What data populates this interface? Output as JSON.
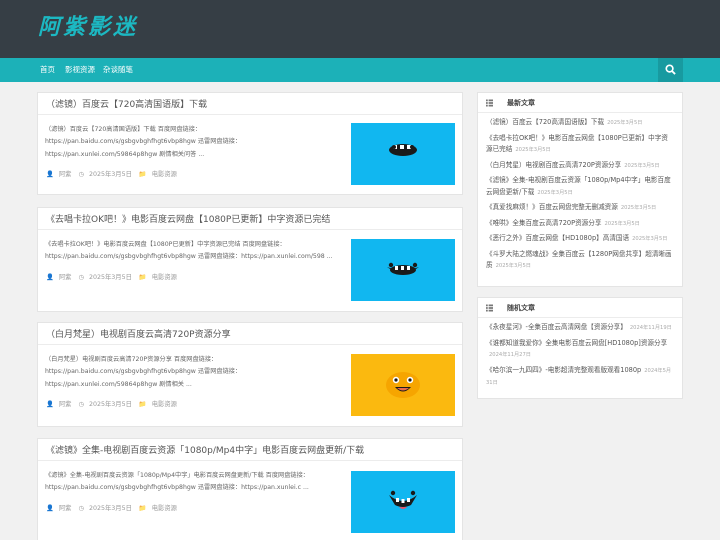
{
  "header": {
    "logo": "阿紫影迷"
  },
  "nav": {
    "items": [
      "首页",
      "影视资源",
      "杂谈随笔"
    ]
  },
  "posts": [
    {
      "title": "（滤镜）百度云【720高清国语版】下载",
      "excerpt": "（滤镜）百度云【720高清国语版】下载 百度网盘链接：https://pan.baidu.com/s/gsbgvbghfhgt6vbp8hgw 迅雷网盘链接：https://pan.xunlei.com/59864p8hgw 剧情相关问答 ...",
      "author": "阿紫",
      "date": "2025年3月5日",
      "category": "电影资源",
      "thumb": "teal"
    },
    {
      "title": "《去唱卡拉OK吧！》电影百度云网盘【1080P已更新】中字资源已完结",
      "excerpt": "《去唱卡拉OK吧！》电影百度云网盘【1080P已更新】中字资源已完结 百度网盘链接：https://pan.baidu.com/s/gsbgvbghfhgt6vbp8hgw 迅雷网盘链接：https://pan.xunlei.com/598 ...",
      "author": "阿紫",
      "date": "2025年3月5日",
      "category": "电影资源",
      "thumb": "teal"
    },
    {
      "title": "（白月梵星）电视剧百度云高清720P资源分享",
      "excerpt": "（白月梵星）电视剧百度云高清720P资源分享 百度网盘链接：https://pan.baidu.com/s/gsbgvbghfhgt6vbp8hgw 迅雷网盘链接：https://pan.xunlei.com/59864p8hgw 剧情相关 ...",
      "author": "阿紫",
      "date": "2025年3月5日",
      "category": "电影资源",
      "thumb": "yellow"
    },
    {
      "title": "《滤镜》全集-电视剧百度云资源「1080p/Mp4中字」电影百度云网盘更新/下载",
      "excerpt": "《滤镜》全集-电视剧百度云资源「1080p/Mp4中字」电影百度云网盘更新/下载 百度网盘链接：https://pan.baidu.com/s/gsbgvbghfhgt6vbp8hgw 迅雷网盘链接：https://pan.xunlei.c ...",
      "author": "阿紫",
      "date": "2025年3月5日",
      "category": "电影资源",
      "thumb": "teal"
    }
  ],
  "sidebar": {
    "latest": {
      "title": "最新文章",
      "items": [
        {
          "text": "（滤镜）百度云【720高清国语版】下载",
          "date": "2025年3月5日"
        },
        {
          "text": "《去唱卡拉OK吧！》电影百度云网盘【1080P已更新】中字资源已完结",
          "date": "2025年3月5日"
        },
        {
          "text": "（白月梵星）电视剧百度云高清720P资源分享",
          "date": "2025年3月5日"
        },
        {
          "text": "《滤镜》全集-电视剧百度云资源「1080p/Mp4中字」电影百度云网盘更新/下载",
          "date": "2025年3月5日"
        },
        {
          "text": "《真爱找麻烦！》百度云网盘完整无删减资源",
          "date": "2025年3月5日"
        },
        {
          "text": "《唯哄》全集百度云高清720P资源分享",
          "date": "2025年3月5日"
        },
        {
          "text": "《恶行之外》百度云网盘【HD1080p】高清国语",
          "date": "2025年3月5日"
        },
        {
          "text": "《斗罗大陆之燃魂战》全集百度云【1280P网盘共享】超清晰画质",
          "date": "2025年3月5日"
        }
      ]
    },
    "random": {
      "title": "随机文章",
      "items": [
        {
          "text": "《永夜星河》-全集百度云高清网盘【资源分享】",
          "date": "2024年11月19日"
        },
        {
          "text": "《谁都知道我爱你》全集电影百度云网盘[HD1080p]资源分享",
          "date": "2024年11月27日"
        },
        {
          "text": "《哈尔滨一九四四》-电影超清完整观看版观看1080p",
          "date": "2024年5月31日"
        }
      ]
    }
  }
}
